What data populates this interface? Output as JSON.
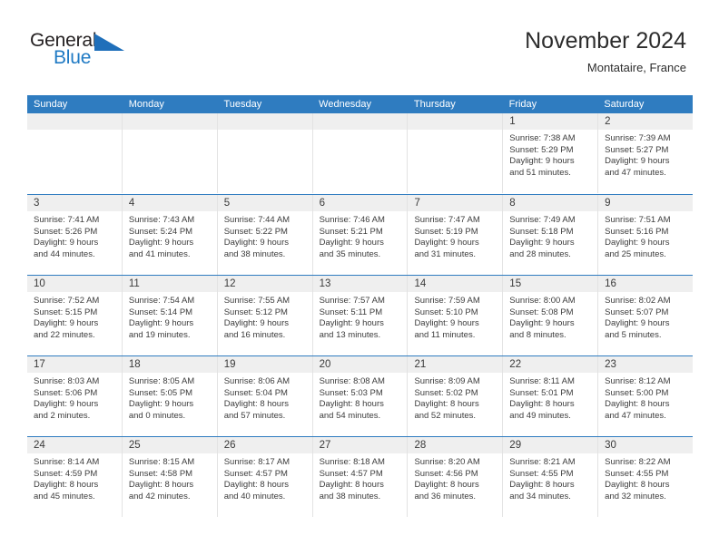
{
  "brand": {
    "name_part1": "General",
    "name_part2": "Blue",
    "flag_icon": "triangle-flag-icon",
    "color_blue": "#1f7ac4",
    "color_dark": "#231f20"
  },
  "header": {
    "title": "November 2024",
    "subtitle": "Montataire, France"
  },
  "theme": {
    "header_blue": "#2f7cc0",
    "daynum_band": "#efefef",
    "cell_border": "#e3e3e3",
    "text": "#3c3c3c"
  },
  "weekdays": [
    "Sunday",
    "Monday",
    "Tuesday",
    "Wednesday",
    "Thursday",
    "Friday",
    "Saturday"
  ],
  "weeks": [
    [
      {
        "day": "",
        "empty": true
      },
      {
        "day": "",
        "empty": true
      },
      {
        "day": "",
        "empty": true
      },
      {
        "day": "",
        "empty": true
      },
      {
        "day": "",
        "empty": true
      },
      {
        "day": "1",
        "sunrise": "Sunrise: 7:38 AM",
        "sunset": "Sunset: 5:29 PM",
        "daylight1": "Daylight: 9 hours",
        "daylight2": "and 51 minutes."
      },
      {
        "day": "2",
        "sunrise": "Sunrise: 7:39 AM",
        "sunset": "Sunset: 5:27 PM",
        "daylight1": "Daylight: 9 hours",
        "daylight2": "and 47 minutes."
      }
    ],
    [
      {
        "day": "3",
        "sunrise": "Sunrise: 7:41 AM",
        "sunset": "Sunset: 5:26 PM",
        "daylight1": "Daylight: 9 hours",
        "daylight2": "and 44 minutes."
      },
      {
        "day": "4",
        "sunrise": "Sunrise: 7:43 AM",
        "sunset": "Sunset: 5:24 PM",
        "daylight1": "Daylight: 9 hours",
        "daylight2": "and 41 minutes."
      },
      {
        "day": "5",
        "sunrise": "Sunrise: 7:44 AM",
        "sunset": "Sunset: 5:22 PM",
        "daylight1": "Daylight: 9 hours",
        "daylight2": "and 38 minutes."
      },
      {
        "day": "6",
        "sunrise": "Sunrise: 7:46 AM",
        "sunset": "Sunset: 5:21 PM",
        "daylight1": "Daylight: 9 hours",
        "daylight2": "and 35 minutes."
      },
      {
        "day": "7",
        "sunrise": "Sunrise: 7:47 AM",
        "sunset": "Sunset: 5:19 PM",
        "daylight1": "Daylight: 9 hours",
        "daylight2": "and 31 minutes."
      },
      {
        "day": "8",
        "sunrise": "Sunrise: 7:49 AM",
        "sunset": "Sunset: 5:18 PM",
        "daylight1": "Daylight: 9 hours",
        "daylight2": "and 28 minutes."
      },
      {
        "day": "9",
        "sunrise": "Sunrise: 7:51 AM",
        "sunset": "Sunset: 5:16 PM",
        "daylight1": "Daylight: 9 hours",
        "daylight2": "and 25 minutes."
      }
    ],
    [
      {
        "day": "10",
        "sunrise": "Sunrise: 7:52 AM",
        "sunset": "Sunset: 5:15 PM",
        "daylight1": "Daylight: 9 hours",
        "daylight2": "and 22 minutes."
      },
      {
        "day": "11",
        "sunrise": "Sunrise: 7:54 AM",
        "sunset": "Sunset: 5:14 PM",
        "daylight1": "Daylight: 9 hours",
        "daylight2": "and 19 minutes."
      },
      {
        "day": "12",
        "sunrise": "Sunrise: 7:55 AM",
        "sunset": "Sunset: 5:12 PM",
        "daylight1": "Daylight: 9 hours",
        "daylight2": "and 16 minutes."
      },
      {
        "day": "13",
        "sunrise": "Sunrise: 7:57 AM",
        "sunset": "Sunset: 5:11 PM",
        "daylight1": "Daylight: 9 hours",
        "daylight2": "and 13 minutes."
      },
      {
        "day": "14",
        "sunrise": "Sunrise: 7:59 AM",
        "sunset": "Sunset: 5:10 PM",
        "daylight1": "Daylight: 9 hours",
        "daylight2": "and 11 minutes."
      },
      {
        "day": "15",
        "sunrise": "Sunrise: 8:00 AM",
        "sunset": "Sunset: 5:08 PM",
        "daylight1": "Daylight: 9 hours",
        "daylight2": "and 8 minutes."
      },
      {
        "day": "16",
        "sunrise": "Sunrise: 8:02 AM",
        "sunset": "Sunset: 5:07 PM",
        "daylight1": "Daylight: 9 hours",
        "daylight2": "and 5 minutes."
      }
    ],
    [
      {
        "day": "17",
        "sunrise": "Sunrise: 8:03 AM",
        "sunset": "Sunset: 5:06 PM",
        "daylight1": "Daylight: 9 hours",
        "daylight2": "and 2 minutes."
      },
      {
        "day": "18",
        "sunrise": "Sunrise: 8:05 AM",
        "sunset": "Sunset: 5:05 PM",
        "daylight1": "Daylight: 9 hours",
        "daylight2": "and 0 minutes."
      },
      {
        "day": "19",
        "sunrise": "Sunrise: 8:06 AM",
        "sunset": "Sunset: 5:04 PM",
        "daylight1": "Daylight: 8 hours",
        "daylight2": "and 57 minutes."
      },
      {
        "day": "20",
        "sunrise": "Sunrise: 8:08 AM",
        "sunset": "Sunset: 5:03 PM",
        "daylight1": "Daylight: 8 hours",
        "daylight2": "and 54 minutes."
      },
      {
        "day": "21",
        "sunrise": "Sunrise: 8:09 AM",
        "sunset": "Sunset: 5:02 PM",
        "daylight1": "Daylight: 8 hours",
        "daylight2": "and 52 minutes."
      },
      {
        "day": "22",
        "sunrise": "Sunrise: 8:11 AM",
        "sunset": "Sunset: 5:01 PM",
        "daylight1": "Daylight: 8 hours",
        "daylight2": "and 49 minutes."
      },
      {
        "day": "23",
        "sunrise": "Sunrise: 8:12 AM",
        "sunset": "Sunset: 5:00 PM",
        "daylight1": "Daylight: 8 hours",
        "daylight2": "and 47 minutes."
      }
    ],
    [
      {
        "day": "24",
        "sunrise": "Sunrise: 8:14 AM",
        "sunset": "Sunset: 4:59 PM",
        "daylight1": "Daylight: 8 hours",
        "daylight2": "and 45 minutes."
      },
      {
        "day": "25",
        "sunrise": "Sunrise: 8:15 AM",
        "sunset": "Sunset: 4:58 PM",
        "daylight1": "Daylight: 8 hours",
        "daylight2": "and 42 minutes."
      },
      {
        "day": "26",
        "sunrise": "Sunrise: 8:17 AM",
        "sunset": "Sunset: 4:57 PM",
        "daylight1": "Daylight: 8 hours",
        "daylight2": "and 40 minutes."
      },
      {
        "day": "27",
        "sunrise": "Sunrise: 8:18 AM",
        "sunset": "Sunset: 4:57 PM",
        "daylight1": "Daylight: 8 hours",
        "daylight2": "and 38 minutes."
      },
      {
        "day": "28",
        "sunrise": "Sunrise: 8:20 AM",
        "sunset": "Sunset: 4:56 PM",
        "daylight1": "Daylight: 8 hours",
        "daylight2": "and 36 minutes."
      },
      {
        "day": "29",
        "sunrise": "Sunrise: 8:21 AM",
        "sunset": "Sunset: 4:55 PM",
        "daylight1": "Daylight: 8 hours",
        "daylight2": "and 34 minutes."
      },
      {
        "day": "30",
        "sunrise": "Sunrise: 8:22 AM",
        "sunset": "Sunset: 4:55 PM",
        "daylight1": "Daylight: 8 hours",
        "daylight2": "and 32 minutes."
      }
    ]
  ]
}
